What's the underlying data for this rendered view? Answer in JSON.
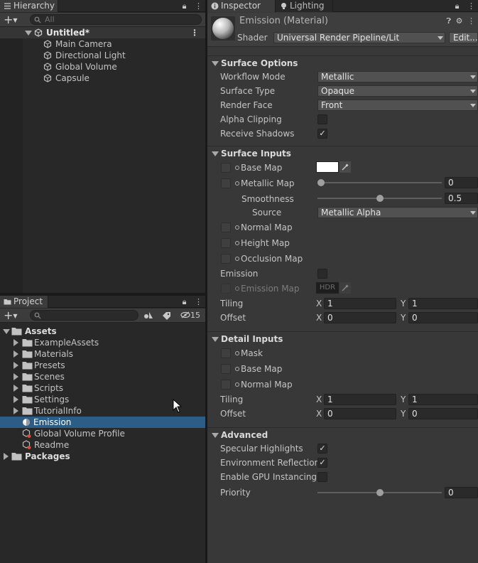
{
  "hierarchy": {
    "tab": "Hierarchy",
    "search_placeholder": "All",
    "scene": "Untitled*",
    "items": [
      "Main Camera",
      "Directional Light",
      "Global Volume",
      "Capsule"
    ]
  },
  "project": {
    "tab": "Project",
    "hidden_count": "15",
    "root": "Assets",
    "folders": [
      "ExampleAssets",
      "Materials",
      "Presets",
      "Scenes",
      "Scripts",
      "Settings",
      "TutorialInfo"
    ],
    "files": [
      "Emission",
      "Global Volume Profile",
      "Readme"
    ],
    "packages": "Packages"
  },
  "inspector": {
    "tabs": [
      "Inspector",
      "Lighting"
    ],
    "material_name": "Emission (Material)",
    "shader_label": "Shader",
    "shader_value": "Universal Render Pipeline/Lit",
    "edit_button": "Edit...",
    "surface_options": {
      "title": "Surface Options",
      "workflow_label": "Workflow Mode",
      "workflow_value": "Metallic",
      "surface_label": "Surface Type",
      "surface_value": "Opaque",
      "render_face_label": "Render Face",
      "render_face_value": "Front",
      "alpha_label": "Alpha Clipping",
      "shadows_label": "Receive Shadows"
    },
    "surface_inputs": {
      "title": "Surface Inputs",
      "base_map": "Base Map",
      "metallic_map": "Metallic Map",
      "metallic_value": "0",
      "metallic_level": 0,
      "smoothness": "Smoothness",
      "smoothness_value": "0.5",
      "smoothness_level": 0.5,
      "source_label": "Source",
      "source_value": "Metallic Alpha",
      "normal_map": "Normal Map",
      "height_map": "Height Map",
      "occlusion_map": "Occlusion Map",
      "emission": "Emission",
      "emission_map": "Emission Map",
      "hdr": "HDR",
      "tiling": "Tiling",
      "tiling_x": "1",
      "tiling_y": "1",
      "offset": "Offset",
      "offset_x": "0",
      "offset_y": "0"
    },
    "detail_inputs": {
      "title": "Detail Inputs",
      "mask": "Mask",
      "base_map": "Base Map",
      "normal_map": "Normal Map",
      "tiling": "Tiling",
      "tiling_x": "1",
      "tiling_y": "1",
      "offset": "Offset",
      "offset_x": "0",
      "offset_y": "0"
    },
    "advanced": {
      "title": "Advanced",
      "specular": "Specular Highlights",
      "env_reflections": "Environment Reflections",
      "gpu_instancing": "Enable GPU Instancing",
      "priority": "Priority",
      "priority_value": "0",
      "priority_level": 0.5
    }
  },
  "axis_labels": {
    "x": "X",
    "y": "Y"
  },
  "colors": {
    "selection": "#2c5d87",
    "panel": "#383838",
    "dark_panel": "#282828"
  }
}
